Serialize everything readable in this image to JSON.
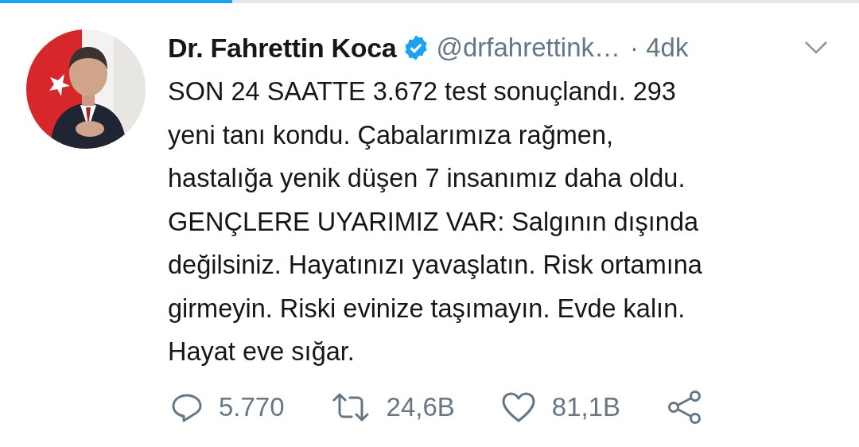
{
  "progress_bar": {
    "level": 0.27
  },
  "tweet": {
    "author": {
      "name": "Dr. Fahrettin Koca",
      "verified": true,
      "handle": "@drfahrettink…",
      "time": "· 4dk"
    },
    "text": "SON 24 SAATTE 3.672 test sonuçlandı. 293\nyeni tanı kondu. Çabalarımıza rağmen,\nhastalığa yenik düşen 7 insanımız daha oldu.\nGENÇLERE UYARIMIZ VAR: Salgının dışında\ndeğilsiniz. Hayatınızı yavaşlatın. Risk ortamına\ngirmeyin. Riski evinize taşımayın. Evde kalın.\nHayat eve sığar.",
    "actions": [
      {
        "kind": "reply",
        "count": "5.770"
      },
      {
        "kind": "retweet",
        "count": "24,6B"
      },
      {
        "kind": "like",
        "count": "81,1B"
      },
      {
        "kind": "share"
      }
    ]
  }
}
